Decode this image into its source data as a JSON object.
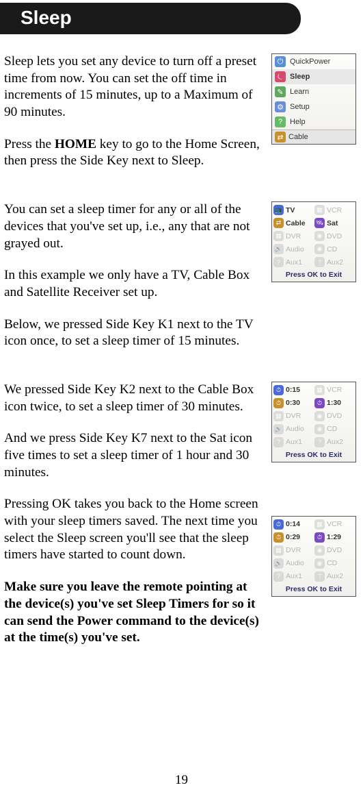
{
  "header": {
    "title": "Sleep"
  },
  "page_number": "19",
  "section1": {
    "p1": "Sleep lets you set any device to turn off a preset time from now. You can set the off time in increments of 15 minutes, up to a Maximum of 90 minutes.",
    "p2_a": "Press the ",
    "p2_b": "HOME",
    "p2_c": " key to go to the Home Screen, then press the Side Key next to Sleep.",
    "menu": {
      "items": [
        {
          "icon_bg": "#5a8fd6",
          "glyph": "⏻",
          "label": "QuickPower"
        },
        {
          "icon_bg": "#d64a6e",
          "glyph": "⏾",
          "label": "Sleep",
          "selected": true
        },
        {
          "icon_bg": "#5fa85f",
          "glyph": "✎",
          "label": "Learn"
        },
        {
          "icon_bg": "#6a8fd6",
          "glyph": "⚙",
          "label": "Setup"
        },
        {
          "icon_bg": "#66bb66",
          "glyph": "?",
          "label": "Help"
        }
      ],
      "footer_icon": "⇄",
      "footer_label": "Cable"
    }
  },
  "section2": {
    "p1": "You can set a sleep timer for any or all of the devices that you've set up, i.e., any that are not grayed out.",
    "p2": "In this example we only have a TV, Cable Box and Satellite Receiver set up.",
    "p3": "Below, we pressed Side Key K1 next to the TV icon once, to set a sleep timer of 15 minutes.",
    "grid": {
      "rows": [
        [
          {
            "glyph": "📺",
            "bg": "#4a6bd6",
            "label": "TV",
            "dim": false
          },
          {
            "glyph": "▦",
            "bg": "#bbb",
            "label": "VCR",
            "dim": true
          }
        ],
        [
          {
            "glyph": "⇄",
            "bg": "#c7902a",
            "label": "Cable",
            "dim": false
          },
          {
            "glyph": "🛰",
            "bg": "#7a4ac2",
            "label": "Sat",
            "dim": false
          }
        ],
        [
          {
            "glyph": "▦",
            "bg": "#bbb",
            "label": "DVR",
            "dim": true
          },
          {
            "glyph": "◉",
            "bg": "#bbb",
            "label": "DVD",
            "dim": true
          }
        ],
        [
          {
            "glyph": "🔊",
            "bg": "#bbb",
            "label": "Audio",
            "dim": true
          },
          {
            "glyph": "◉",
            "bg": "#bbb",
            "label": "CD",
            "dim": true
          }
        ],
        [
          {
            "glyph": "?",
            "bg": "#bbb",
            "label": "Aux1",
            "dim": true
          },
          {
            "glyph": "?",
            "bg": "#bbb",
            "label": "Aux2",
            "dim": true
          }
        ]
      ],
      "footer": "Press OK to Exit"
    }
  },
  "section3": {
    "p1": "We pressed Side Key K2 next to the Cable Box icon twice, to set a sleep timer of 30 minutes.",
    "p2": "And we press Side Key K7 next to the Sat icon five times to set a sleep timer of 1 hour and 30 minutes.",
    "p3": "Pressing OK takes you back to the Home screen with your sleep timers saved. The next time you select the Sleep screen you'll see that the sleep timers have started to count down.",
    "p4": "Make sure you leave the remote pointing at the device(s) you've set Sleep Timers for so it can send the Power command to the device(s) at the time(s) you've set.",
    "grid_a": {
      "rows": [
        [
          {
            "glyph": "⏱",
            "bg": "#4a6bd6",
            "label": "0:15",
            "dim": false
          },
          {
            "glyph": "▦",
            "bg": "#bbb",
            "label": "VCR",
            "dim": true
          }
        ],
        [
          {
            "glyph": "⏱",
            "bg": "#c7902a",
            "label": "0:30",
            "dim": false
          },
          {
            "glyph": "⏱",
            "bg": "#7a4ac2",
            "label": "1:30",
            "dim": false
          }
        ],
        [
          {
            "glyph": "▦",
            "bg": "#bbb",
            "label": "DVR",
            "dim": true
          },
          {
            "glyph": "◉",
            "bg": "#bbb",
            "label": "DVD",
            "dim": true
          }
        ],
        [
          {
            "glyph": "🔊",
            "bg": "#bbb",
            "label": "Audio",
            "dim": true
          },
          {
            "glyph": "◉",
            "bg": "#bbb",
            "label": "CD",
            "dim": true
          }
        ],
        [
          {
            "glyph": "?",
            "bg": "#bbb",
            "label": "Aux1",
            "dim": true
          },
          {
            "glyph": "?",
            "bg": "#bbb",
            "label": "Aux2",
            "dim": true
          }
        ]
      ],
      "footer": "Press OK to Exit"
    },
    "grid_b": {
      "rows": [
        [
          {
            "glyph": "⏱",
            "bg": "#4a6bd6",
            "label": "0:14",
            "dim": false
          },
          {
            "glyph": "▦",
            "bg": "#bbb",
            "label": "VCR",
            "dim": true
          }
        ],
        [
          {
            "glyph": "⏱",
            "bg": "#c7902a",
            "label": "0:29",
            "dim": false
          },
          {
            "glyph": "⏱",
            "bg": "#7a4ac2",
            "label": "1:29",
            "dim": false
          }
        ],
        [
          {
            "glyph": "▦",
            "bg": "#bbb",
            "label": "DVR",
            "dim": true
          },
          {
            "glyph": "◉",
            "bg": "#bbb",
            "label": "DVD",
            "dim": true
          }
        ],
        [
          {
            "glyph": "🔊",
            "bg": "#bbb",
            "label": "Audio",
            "dim": true
          },
          {
            "glyph": "◉",
            "bg": "#bbb",
            "label": "CD",
            "dim": true
          }
        ],
        [
          {
            "glyph": "?",
            "bg": "#bbb",
            "label": "Aux1",
            "dim": true
          },
          {
            "glyph": "?",
            "bg": "#bbb",
            "label": "Aux2",
            "dim": true
          }
        ]
      ],
      "footer": "Press OK to Exit"
    }
  }
}
